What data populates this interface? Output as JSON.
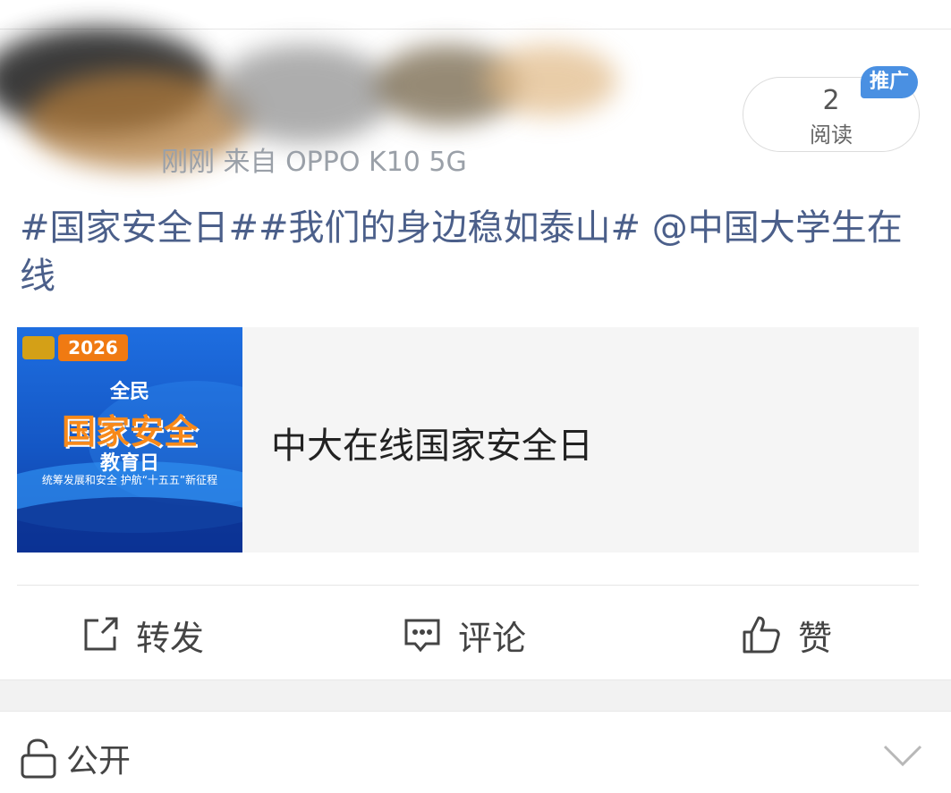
{
  "post": {
    "meta": "刚刚  来自 OPPO K10 5G",
    "read_count": "2",
    "read_label": "阅读",
    "promo_badge": "推广",
    "text": "#国家安全日##我们的身边稳如泰山# @中国大学生在线"
  },
  "card": {
    "title": "中大在线国家安全日",
    "thumb": {
      "year": "2026",
      "line1": "全民",
      "line2": "国家安全",
      "line3": "教育日",
      "slogan": "统筹发展和安全 护航“十五五”新征程"
    }
  },
  "actions": {
    "repost": "转发",
    "comment": "评论",
    "like": "赞"
  },
  "footer": {
    "visibility": "公开"
  },
  "icons": {
    "repost": "share-edit-icon",
    "comment": "comment-bubble-icon",
    "like": "thumbs-up-icon",
    "lock": "lock-open-icon",
    "expand": "chevron-down-icon"
  },
  "colors": {
    "hashtag_text": "#4b5f8a",
    "promo_badge": "#4a90e2",
    "thumb_orange": "#f07a12"
  }
}
